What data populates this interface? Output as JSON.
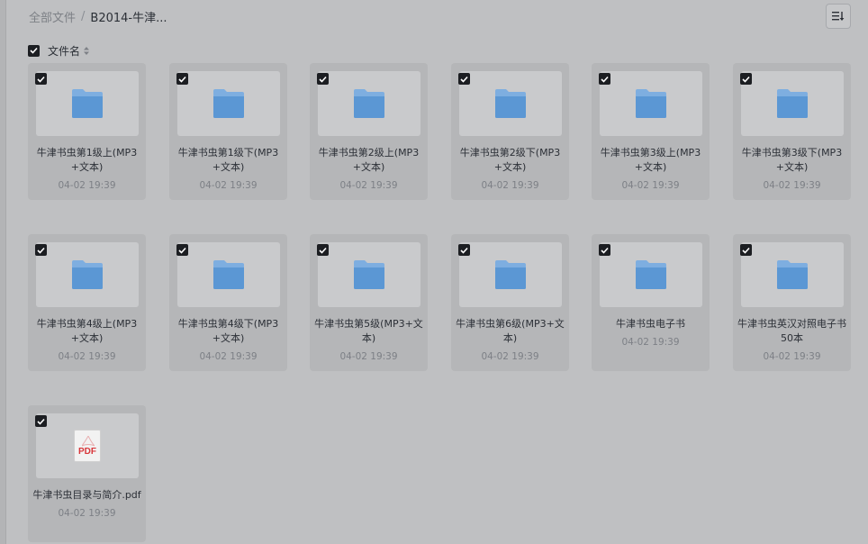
{
  "breadcrumb": {
    "root": "全部文件",
    "separator": "/",
    "current": "B2014-牛津..."
  },
  "toolbar": {
    "sort_icon": "sort-list-icon"
  },
  "header": {
    "column_label": "文件名",
    "select_all_checked": true
  },
  "files": [
    {
      "name": "牛津书虫第1级上(MP3+文本)",
      "time": "04-02 19:39",
      "type": "folder",
      "checked": true
    },
    {
      "name": "牛津书虫第1级下(MP3+文本)",
      "time": "04-02 19:39",
      "type": "folder",
      "checked": true
    },
    {
      "name": "牛津书虫第2级上(MP3+文本)",
      "time": "04-02 19:39",
      "type": "folder",
      "checked": true
    },
    {
      "name": "牛津书虫第2级下(MP3+文本)",
      "time": "04-02 19:39",
      "type": "folder",
      "checked": true
    },
    {
      "name": "牛津书虫第3级上(MP3+文本)",
      "time": "04-02 19:39",
      "type": "folder",
      "checked": true
    },
    {
      "name": "牛津书虫第3级下(MP3+文本)",
      "time": "04-02 19:39",
      "type": "folder",
      "checked": true
    },
    {
      "name": "牛津书虫第4级上(MP3+文本)",
      "time": "04-02 19:39",
      "type": "folder",
      "checked": true
    },
    {
      "name": "牛津书虫第4级下(MP3+文本)",
      "time": "04-02 19:39",
      "type": "folder",
      "checked": true
    },
    {
      "name": "牛津书虫第5级(MP3+文本)",
      "time": "04-02 19:39",
      "type": "folder",
      "checked": true
    },
    {
      "name": "牛津书虫第6级(MP3+文本)",
      "time": "04-02 19:39",
      "type": "folder",
      "checked": true
    },
    {
      "name": "牛津书虫电子书",
      "time": "04-02 19:39",
      "type": "folder",
      "checked": true
    },
    {
      "name": "牛津书虫英汉对照电子书50本",
      "time": "04-02 19:39",
      "type": "folder",
      "checked": true
    },
    {
      "name": "牛津书虫目录与简介.pdf",
      "time": "04-02 19:39",
      "type": "pdf",
      "checked": true,
      "icon_text": "PDF"
    }
  ],
  "colors": {
    "folder_top": "#7eaee0",
    "folder_body": "#5b97d4",
    "pdf_red": "#d8363a"
  }
}
